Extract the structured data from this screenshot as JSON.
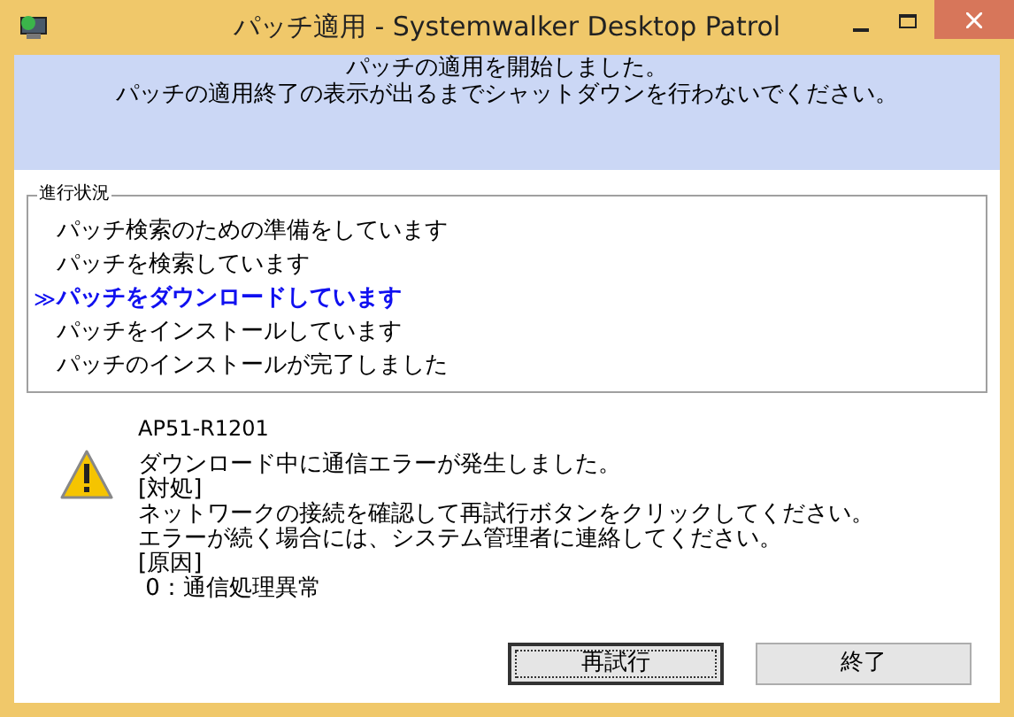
{
  "window": {
    "title": "パッチ適用 - Systemwalker Desktop Patrol"
  },
  "header": {
    "lines": [
      "パッチの適用を開始しました。",
      "パッチの適用終了の表示が出るまでシャットダウンを行わないでください。"
    ]
  },
  "progress": {
    "title": "進行状況",
    "current_marker": "≫",
    "steps": [
      {
        "label": "パッチ検索のための準備をしています",
        "current": false
      },
      {
        "label": "パッチを検索しています",
        "current": false
      },
      {
        "label": "パッチをダウンロードしています",
        "current": true
      },
      {
        "label": "パッチをインストールしています",
        "current": false
      },
      {
        "label": "パッチのインストールが完了しました",
        "current": false
      }
    ]
  },
  "error": {
    "code": "AP51-R1201",
    "lines": [
      "ダウンロード中に通信エラーが発生しました。",
      "[対処]",
      "ネットワークの接続を確認して再試行ボタンをクリックしてください。",
      "エラーが続く場合には、システム管理者に連絡してください。",
      "[原因]",
      " 0：通信処理異常"
    ]
  },
  "buttons": [
    {
      "label": "再試行",
      "focused": true
    },
    {
      "label": "終了",
      "focused": false
    }
  ]
}
